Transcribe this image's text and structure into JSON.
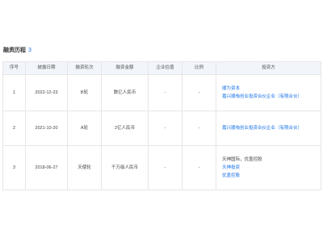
{
  "section": {
    "title": "融资历程",
    "count": "3"
  },
  "table": {
    "headers": [
      "序号",
      "披露日期",
      "融资轮次",
      "融资金额",
      "企业估值",
      "比例",
      "投资方"
    ],
    "rows": [
      {
        "index": "1",
        "date": "2022-12-23",
        "round": "B轮",
        "amount": "数亿人民币",
        "valuation": "-",
        "ratio": "-",
        "investors": [
          {
            "text": "顺为资本",
            "link": true
          },
          {
            "text": "嘉兴顺侑创业投资合伙企业（有限合伙）",
            "link": true
          }
        ]
      },
      {
        "index": "2",
        "date": "2021-10-20",
        "round": "A轮",
        "amount": "2亿人民币",
        "valuation": "-",
        "ratio": "-",
        "investors": [
          {
            "text": "嘉兴顺侑创业投资合伙企业（有限合伙）",
            "link": true
          }
        ]
      },
      {
        "index": "3",
        "date": "2018-06-27",
        "round": "天使轮",
        "amount": "千万级人民币",
        "valuation": "-",
        "ratio": "-",
        "investors": [
          {
            "text": "天神国际，优盖控股",
            "link": false
          },
          {
            "text": "天神投资",
            "link": true
          },
          {
            "text": "优盖控股",
            "link": true
          }
        ]
      }
    ]
  }
}
